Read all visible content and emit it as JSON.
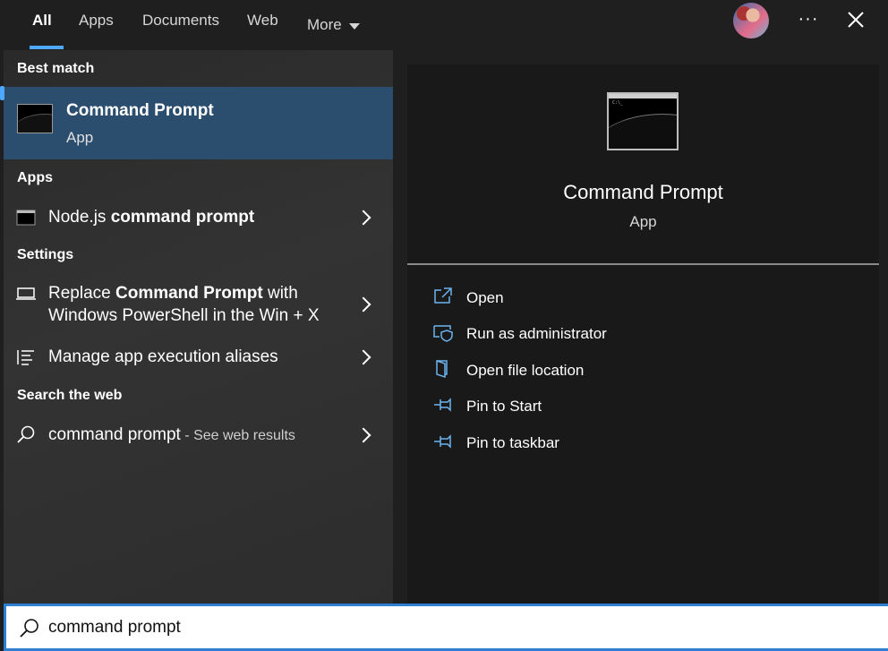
{
  "tabs": [
    {
      "label": "All"
    },
    {
      "label": "Apps"
    },
    {
      "label": "Documents"
    },
    {
      "label": "Web"
    },
    {
      "label": "More"
    }
  ],
  "sections": {
    "best_match": "Best match",
    "apps": "Apps",
    "settings": "Settings",
    "search_web": "Search the web"
  },
  "best_match": {
    "title": "Command Prompt",
    "subtitle": "App"
  },
  "results": {
    "nodejs": {
      "plain": "Node.js ",
      "bold": "command prompt"
    },
    "replace": {
      "pre": "Replace ",
      "bold": "Command Prompt",
      "post": " with",
      "line2": "Windows PowerShell in the Win + X"
    },
    "aliases": "Manage app execution aliases",
    "web": {
      "query": "command prompt",
      "suffix": " - See web results"
    }
  },
  "preview": {
    "title": "Command Prompt",
    "subtitle": "App",
    "actions": [
      {
        "label": "Open",
        "icon": "open-icon"
      },
      {
        "label": "Run as administrator",
        "icon": "shield-icon"
      },
      {
        "label": "Open file location",
        "icon": "folder-icon"
      },
      {
        "label": "Pin to Start",
        "icon": "pin-icon"
      },
      {
        "label": "Pin to taskbar",
        "icon": "pin-icon"
      }
    ]
  },
  "search": {
    "value": "command prompt"
  },
  "colors": {
    "accent": "#4ea8ff",
    "selected": "#2b4d6e",
    "icon_blue": "#6cb4f0"
  }
}
